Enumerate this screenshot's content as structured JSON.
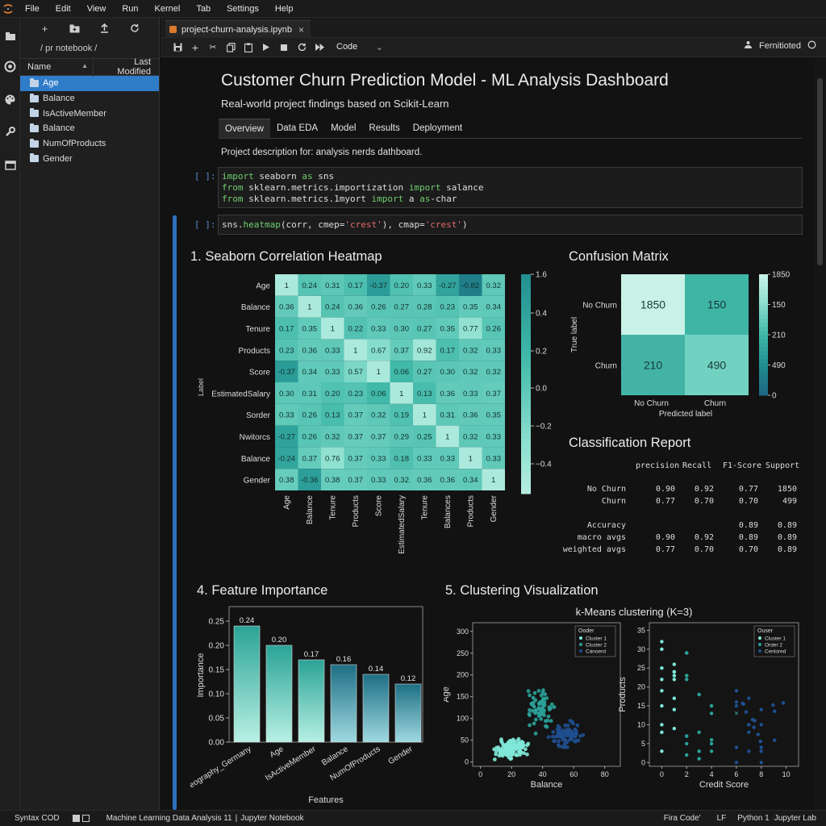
{
  "menubar": {
    "items": [
      "File",
      "Edit",
      "View",
      "Run",
      "Kernel",
      "Tab",
      "Settings",
      "Help"
    ]
  },
  "filebrowser": {
    "path": "/ pr notebook /",
    "col_name": "Name",
    "col_modified": "Last Modified",
    "items": [
      {
        "label": "Age",
        "selected": true
      },
      {
        "label": "Balance",
        "selected": false
      },
      {
        "label": "IsActiveMember",
        "selected": false
      },
      {
        "label": "Balance",
        "selected": false
      },
      {
        "label": "NumOfProducts",
        "selected": false
      },
      {
        "label": "Gender",
        "selected": false
      }
    ]
  },
  "tab": {
    "label": "project-churn-analysis.ipynb"
  },
  "toolbar": {
    "cell_type": "Code",
    "kernel_status": "Fernitioted"
  },
  "notebook": {
    "title": "Customer Churn Prediction Model - ML Analysis Dashboard",
    "subtitle": "Real-world project findings based on Scikit-Learn",
    "tabs": [
      "Overview",
      "Data EDA",
      "Model",
      "Results",
      "Deployment"
    ],
    "description": "Project description for: analysis nerds dathboard.",
    "prompt1": "[ ]:",
    "prompt2": "[ ]:",
    "cell1": [
      [
        [
          "kw",
          "import"
        ],
        [
          "t",
          " seaborn "
        ],
        [
          "kw",
          "as"
        ],
        [
          "t",
          " sns"
        ]
      ],
      [
        [
          "kw",
          "from"
        ],
        [
          "t",
          " sklearn.metrics.importization "
        ],
        [
          "kw",
          "import"
        ],
        [
          "t",
          " salance"
        ]
      ],
      [
        [
          "kw",
          "from"
        ],
        [
          "t",
          " sklearn.metrics.1myort "
        ],
        [
          "kw",
          "import"
        ],
        [
          "t",
          " a "
        ],
        [
          "kw",
          "as"
        ],
        [
          "t",
          "-char"
        ]
      ]
    ],
    "cell2": [
      [
        [
          "t",
          "sns."
        ],
        [
          "kw",
          "heatmap"
        ],
        [
          "t",
          "(corr, cmep="
        ],
        [
          "str",
          "'crest'"
        ],
        [
          "t",
          "), cmap="
        ],
        [
          "str",
          "'crest'"
        ],
        [
          "t",
          ")"
        ]
      ]
    ]
  },
  "sections": {
    "heatmap": "1. Seaborn Correlation Heatmap",
    "confusion": "Confusion Matrix",
    "report": "Classification Report",
    "importance": "4. Feature Importance",
    "clustering": "5. Clustering Visualization"
  },
  "report": {
    "headers": [
      "precision",
      "Recall",
      "F1-Score",
      "Support"
    ],
    "rows": [
      {
        "label": "No Churn",
        "values": [
          "0.90",
          "0.92",
          "0.77",
          "1850"
        ]
      },
      {
        "label": "Churn",
        "values": [
          "0.77",
          "0.70",
          "0.70",
          "499"
        ]
      },
      {
        "label": "Accuracy",
        "values": [
          "",
          "",
          "0.89",
          "0.89"
        ]
      },
      {
        "label": "macro avgs",
        "values": [
          "0.90",
          "0.92",
          "0.89",
          "0.89"
        ]
      },
      {
        "label": "weighted avgs",
        "values": [
          "0.77",
          "0.70",
          "0.70",
          "0.89"
        ]
      }
    ]
  },
  "statusbar": {
    "left": "Syntax COD",
    "mid1": "Machine Learning Data Analysis 11",
    "mid2": "Jupyter Notebook",
    "font": "Fira Code'",
    "eol": "LF",
    "kernel": "Python 1",
    "app": "Jupyter Lab"
  },
  "colors": {
    "accent": "#2e6fbd",
    "selected": "#2f7cc9",
    "keyword": "#6fcf6f",
    "string": "#e06a6a"
  },
  "chart_data": [
    {
      "type": "heatmap",
      "title": "",
      "ylabel": "Label",
      "rows": [
        "Age",
        "Balance",
        "Tenure",
        "Products",
        "Score",
        "EstimatedSalary",
        "Sorder",
        "Nwitorcs",
        "Balance",
        "Gender"
      ],
      "cols": [
        "Age",
        "Balance",
        "Tenure",
        "Products",
        "Score",
        "EstimatedSalary",
        "Tenure",
        "Balances",
        "Products",
        "Gender"
      ],
      "values": [
        [
          1,
          0.24,
          0.31,
          0.17,
          -0.37,
          0.2,
          0.33,
          -0.27,
          -0.82,
          0.32
        ],
        [
          0.36,
          1,
          0.24,
          0.36,
          0.26,
          0.27,
          0.28,
          0.23,
          0.35,
          0.34
        ],
        [
          0.17,
          0.35,
          1,
          0.22,
          0.33,
          0.3,
          0.27,
          0.35,
          0.77,
          0.26
        ],
        [
          0.23,
          0.36,
          0.33,
          1,
          0.67,
          0.37,
          0.92,
          0.17,
          0.32,
          0.33
        ],
        [
          -0.37,
          0.34,
          0.33,
          0.57,
          1,
          0.06,
          0.27,
          0.3,
          0.32,
          0.32
        ],
        [
          0.3,
          0.31,
          0.2,
          0.23,
          0.06,
          1,
          0.13,
          0.36,
          0.33,
          0.37
        ],
        [
          0.33,
          0.26,
          0.13,
          0.37,
          0.32,
          0.19,
          1,
          0.31,
          0.36,
          0.35
        ],
        [
          -0.27,
          0.26,
          0.32,
          0.37,
          0.37,
          0.29,
          0.25,
          1,
          0.32,
          0.33
        ],
        [
          -0.24,
          0.37,
          0.76,
          0.37,
          0.33,
          0.18,
          0.33,
          0.33,
          1,
          0.33
        ],
        [
          0.38,
          -0.36,
          0.38,
          0.37,
          0.33,
          0.32,
          0.36,
          0.36,
          0.34,
          1
        ]
      ],
      "colorbar_ticks": [
        "1.6",
        "0.4",
        "0.2",
        "0.0",
        "−0.2",
        "−0.4"
      ]
    },
    {
      "type": "heatmap",
      "title": "",
      "xlabel": "Predicted label",
      "ylabel": "True label",
      "rows": [
        "No Churn",
        "Churn"
      ],
      "cols": [
        "No Churn",
        "Churn"
      ],
      "values": [
        [
          1850,
          150
        ],
        [
          210,
          490
        ]
      ],
      "colorbar_ticks": [
        "1850",
        "150",
        "210",
        "490",
        "0"
      ]
    },
    {
      "type": "bar",
      "title": "",
      "xlabel": "Features",
      "ylabel": "Importance",
      "categories": [
        "Geography_Germany",
        "Age",
        "IsActiveMember",
        "Balance",
        "NumOfProducts",
        "Gender"
      ],
      "values": [
        0.24,
        0.2,
        0.17,
        0.16,
        0.14,
        0.12
      ],
      "ylim": [
        0,
        0.28
      ],
      "yticks": [
        "0.00",
        "0.05",
        "0.10",
        "0.15",
        "0.20",
        "0.25"
      ]
    },
    {
      "type": "scatter",
      "title": "k-Means clustering (K=3)",
      "xlabel": "Balance",
      "ylabel": "Age",
      "xlim": [
        -5,
        90
      ],
      "ylim": [
        -10,
        320
      ],
      "xticks": [
        0,
        20,
        40,
        60,
        80
      ],
      "yticks": [
        0,
        50,
        100,
        150,
        200,
        250,
        300
      ],
      "legend_title": "Ooder",
      "legend": [
        "Cluster 1",
        "Cluster 2",
        "Canoerd"
      ],
      "series_colors": [
        "#7fe8d8",
        "#2aa198",
        "#1f4f8f"
      ]
    },
    {
      "type": "scatter",
      "title": "",
      "xlabel": "Credit Score",
      "ylabel": "Products",
      "xlim": [
        -1,
        11
      ],
      "ylim": [
        -1,
        37
      ],
      "xticks": [
        0,
        2,
        4,
        6,
        8,
        10
      ],
      "yticks": [
        0,
        5,
        10,
        15,
        20,
        25,
        30,
        35
      ],
      "legend_title": "Ouser",
      "legend": [
        "Cluster 1",
        "Order 2",
        "Cenlored"
      ],
      "series_colors": [
        "#7fe8d8",
        "#2aa198",
        "#1f4f8f"
      ]
    }
  ]
}
